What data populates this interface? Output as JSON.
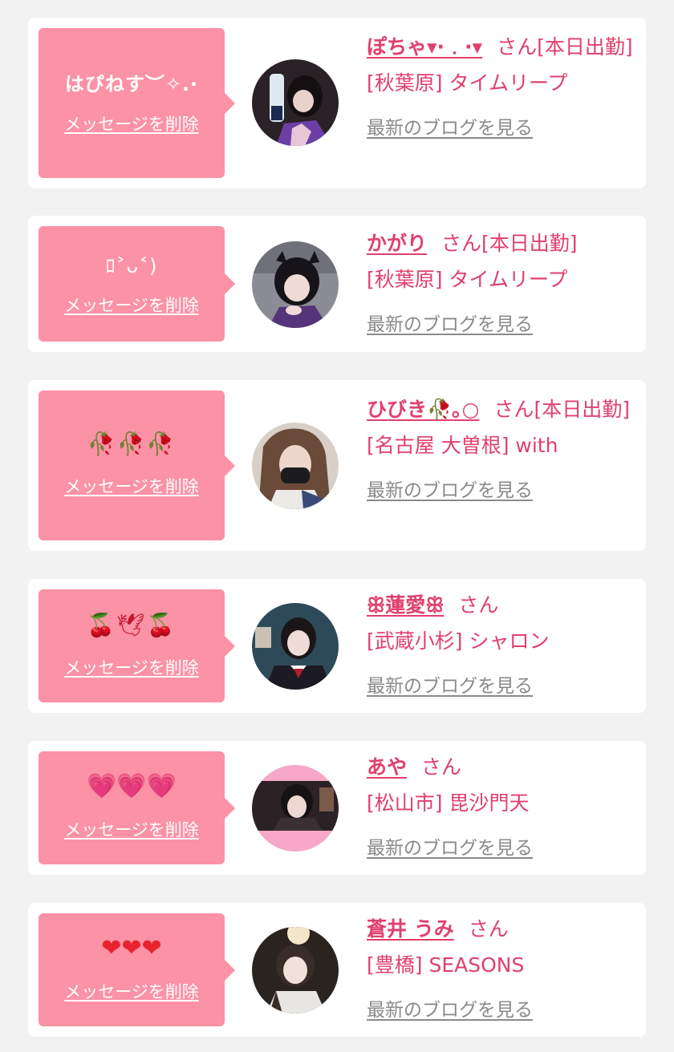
{
  "cards": [
    {
      "message": "はぴねす︶✧.·",
      "delete_label": "メッセージを削除",
      "name": "ぽちゃ▾·﹒·▾",
      "suffix": "さん[本日出勤]",
      "shop": "[秋葉原] タイムリープ",
      "blog_label": "最新のブログを見る"
    },
    {
      "message": "ﾛ˃ᴗ˂)",
      "delete_label": "メッセージを削除",
      "name": "かがり",
      "suffix": "さん[本日出勤]",
      "shop": "[秋葉原] タイムリープ",
      "blog_label": "最新のブログを見る"
    },
    {
      "message": "🥀🥀🥀",
      "delete_label": "メッセージを削除",
      "name": "ひびき🥀｡○",
      "suffix": "さん[本日出勤]",
      "shop": "[名古屋 大曽根] with",
      "blog_label": "最新のブログを見る"
    },
    {
      "message": "🍒🕊🍒",
      "delete_label": "メッセージを削除",
      "name": "ꕥ蓮愛ꕥ",
      "suffix": "さん",
      "shop": "[武蔵小杉] シャロン",
      "blog_label": "最新のブログを見る"
    },
    {
      "message": "💗💗💗",
      "delete_label": "メッセージを削除",
      "name": "あや",
      "suffix": "さん",
      "shop": "[松山市] 毘沙門天",
      "blog_label": "最新のブログを見る"
    },
    {
      "message": "❤❤❤",
      "delete_label": "メッセージを削除",
      "name": "蒼井 うみ",
      "suffix": "さん",
      "shop": "[豊橋] SEASONS",
      "blog_label": "最新のブログを見る"
    }
  ],
  "colors": {
    "background": "#f2f2f2",
    "card": "#ffffff",
    "bubble": "#fb92a6",
    "accent_text": "#e0406c",
    "link_gray": "#8a8a8a"
  }
}
